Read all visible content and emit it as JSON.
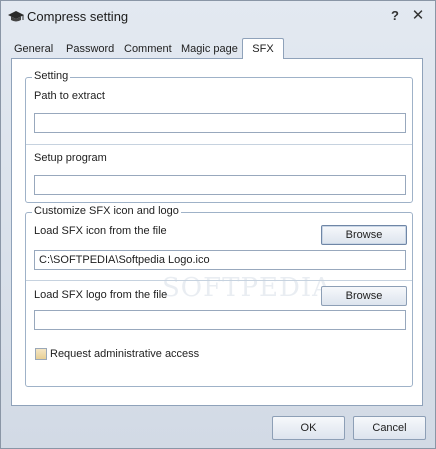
{
  "window": {
    "title": "Compress setting",
    "help_glyph": "?",
    "close_glyph": "✕"
  },
  "tabs": [
    {
      "label": "General"
    },
    {
      "label": "Password"
    },
    {
      "label": "Comment"
    },
    {
      "label": "Magic page"
    },
    {
      "label": "SFX",
      "active": true
    }
  ],
  "setting_group": {
    "legend": "Setting",
    "path_label": "Path to extract",
    "path_value": "",
    "setup_label": "Setup program",
    "setup_value": ""
  },
  "sfx_group": {
    "legend": "Customize SFX icon and logo",
    "icon_label": "Load SFX icon from the file",
    "icon_browse": "Browse",
    "icon_value": "C:\\SOFTPEDIA\\Softpedia Logo.ico",
    "logo_label": "Load SFX logo from the file",
    "logo_browse": "Browse",
    "logo_value": "",
    "admin_checkbox_label": "Request administrative access",
    "admin_checked": false
  },
  "watermark": "SOFTPEDIA",
  "footer": {
    "ok": "OK",
    "cancel": "Cancel"
  },
  "icons": {
    "app": "graduation-cap-icon",
    "help": "question-icon",
    "close": "close-icon"
  }
}
